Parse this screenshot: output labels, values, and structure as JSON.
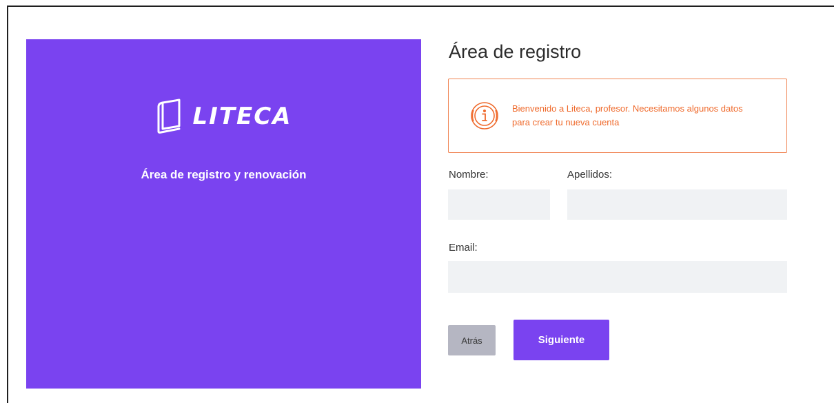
{
  "brand": {
    "logo_text": "LITECA",
    "panel_subtitle": "Área de registro y renovación",
    "accent_color": "#7a43f0"
  },
  "form": {
    "title": "Área de registro",
    "alert": {
      "icon": "info-icon",
      "message": "Bienvenido a Liteca, profesor. Necesitamos algunos datos para crear tu nueva cuenta",
      "color": "#ef6a2c"
    },
    "fields": {
      "nombre": {
        "label": "Nombre:",
        "value": "",
        "placeholder": ""
      },
      "apellidos": {
        "label": "Apellidos:",
        "value": "",
        "placeholder": ""
      },
      "email": {
        "label": "Email:",
        "value": "",
        "placeholder": ""
      }
    },
    "buttons": {
      "back_label": "Atrás",
      "next_label": "Siguiente"
    }
  }
}
